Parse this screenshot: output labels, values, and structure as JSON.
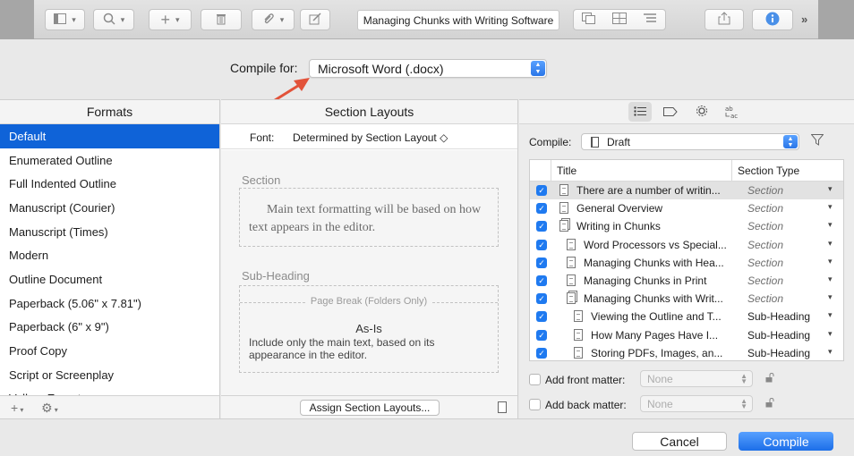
{
  "toolbar": {
    "document_title": "Managing Chunks with Writing Software",
    "overflow": "»"
  },
  "compile_for": {
    "label": "Compile for:",
    "value": "Microsoft Word (.docx)"
  },
  "formats": {
    "header": "Formats",
    "items": [
      "Default",
      "Enumerated Outline",
      "Full Indented Outline",
      "Manuscript (Courier)",
      "Manuscript (Times)",
      "Modern",
      "Outline Document",
      "Paperback (5.06\" x 7.81\")",
      "Paperback (6\" x 9\")",
      "Proof Copy",
      "Script or Screenplay",
      "Vellum Export"
    ],
    "selected": "Default",
    "add_symbol": "+",
    "gear_symbol": "⚙"
  },
  "section_layouts": {
    "header": "Section Layouts",
    "font_label": "Font:",
    "font_value": "Determined by Section Layout ◇",
    "section_title": "Section",
    "section_text": "Main text formatting will be based on how text appears in the editor.",
    "subheading_title": "Sub-Heading",
    "page_break": "Page Break (Folders Only)",
    "as_is_title": "As-Is",
    "as_is_text": "Include only the main text, based on its appearance in the editor.",
    "assign_button": "Assign Section Layouts..."
  },
  "contents": {
    "compile_label": "Compile:",
    "compile_value": "Draft",
    "columns": {
      "title": "Title",
      "section_type": "Section Type"
    },
    "rows": [
      {
        "title": "There are a number of writin...",
        "type": "Section",
        "italic": true,
        "indent": 0,
        "folder": false
      },
      {
        "title": "General Overview",
        "type": "Section",
        "italic": true,
        "indent": 0,
        "folder": false
      },
      {
        "title": "Writing in Chunks",
        "type": "Section",
        "italic": true,
        "indent": 0,
        "folder": true
      },
      {
        "title": "Word Processors vs Special...",
        "type": "Section",
        "italic": true,
        "indent": 1,
        "folder": false
      },
      {
        "title": "Managing Chunks with Hea...",
        "type": "Section",
        "italic": true,
        "indent": 1,
        "folder": false
      },
      {
        "title": "Managing Chunks in Print",
        "type": "Section",
        "italic": true,
        "indent": 1,
        "folder": false
      },
      {
        "title": "Managing Chunks with Writ...",
        "type": "Section",
        "italic": true,
        "indent": 1,
        "folder": true
      },
      {
        "title": "Viewing the Outline and T...",
        "type": "Sub-Heading",
        "italic": false,
        "indent": 2,
        "folder": false
      },
      {
        "title": "How Many Pages Have I...",
        "type": "Sub-Heading",
        "italic": false,
        "indent": 2,
        "folder": false
      },
      {
        "title": "Storing PDFs, Images, an...",
        "type": "Sub-Heading",
        "italic": false,
        "indent": 2,
        "folder": false
      }
    ],
    "front_matter": {
      "label": "Add front matter:",
      "value": "None"
    },
    "back_matter": {
      "label": "Add back matter:",
      "value": "None"
    }
  },
  "buttons": {
    "cancel": "Cancel",
    "compile": "Compile"
  },
  "colors": {
    "accent": "#0f63d8",
    "arrow": "#e2533a"
  }
}
